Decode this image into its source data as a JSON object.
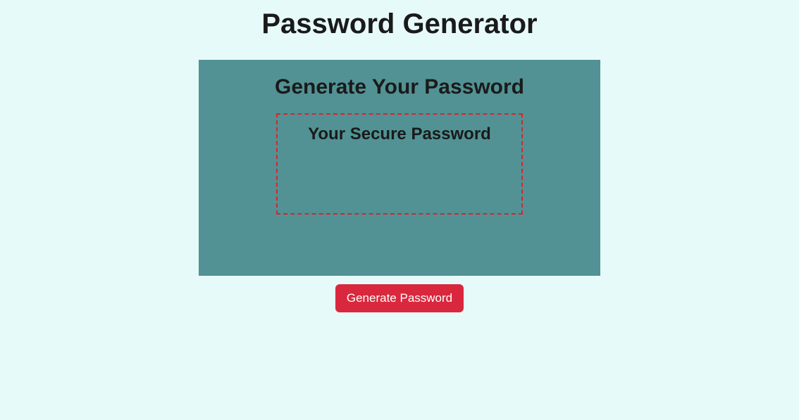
{
  "page": {
    "title": "Password Generator"
  },
  "card": {
    "title": "Generate Your Password",
    "password_label": "Your Secure Password"
  },
  "button": {
    "generate_label": "Generate Password"
  },
  "colors": {
    "background": "#e7fafa",
    "card_bg": "#529294",
    "border_dashed": "#d5262e",
    "button_bg": "#d9283d"
  }
}
